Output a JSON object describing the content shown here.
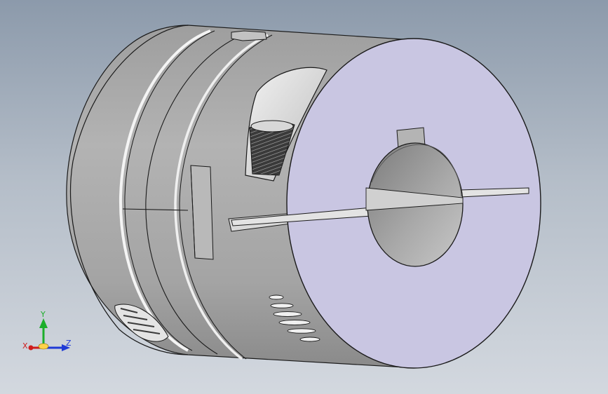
{
  "viewport": {
    "background_top": "#8c9aab",
    "background_bottom": "#d3d8df"
  },
  "model": {
    "body_color": "#a7a7a7",
    "end_face_color": "#c9c6e2",
    "edge_color": "#1a1a1a"
  },
  "triad": {
    "x_label": "X",
    "y_label": "Y",
    "z_label": "Z",
    "x_color": "#d01c1c",
    "y_color": "#1cae2a",
    "z_color": "#1f3ad6"
  }
}
